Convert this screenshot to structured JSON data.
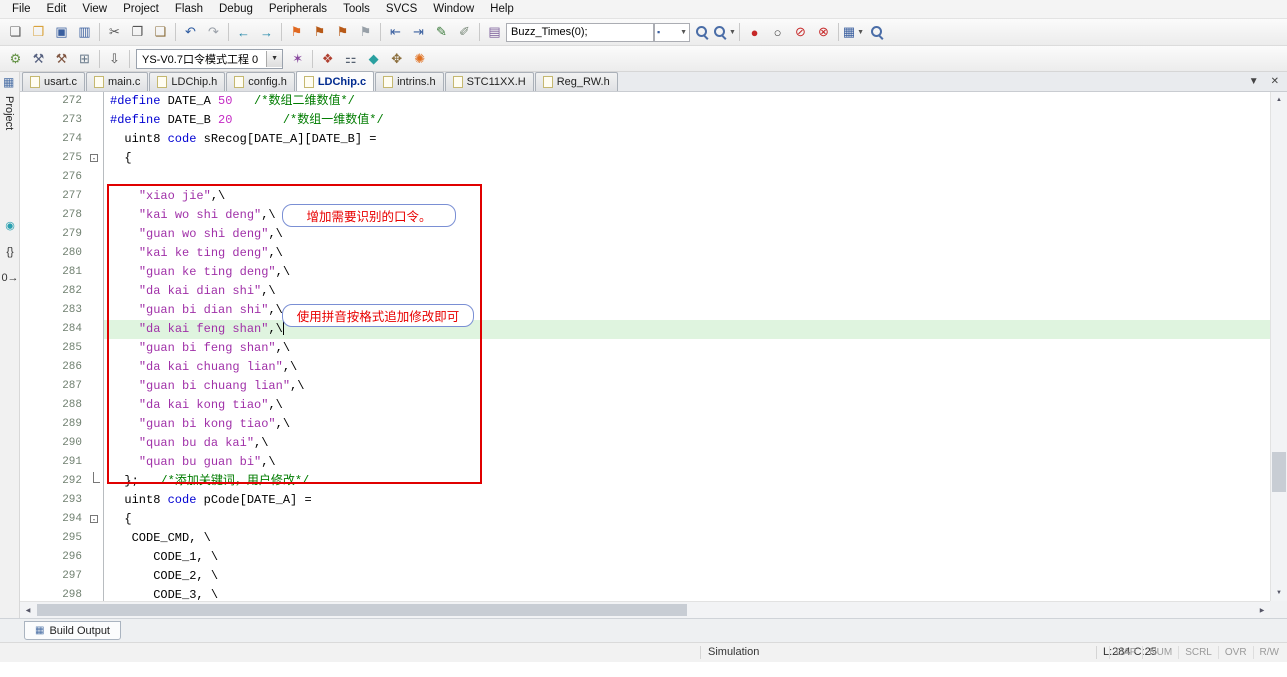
{
  "colors": {
    "keyword": "#0000d2",
    "comment": "#007c00",
    "string": "#a030a8",
    "number": "#c42ac4",
    "line_highlight": "#dff4df",
    "annotation": "#e00000",
    "callout": "#e80000",
    "callout_border": "#7a8fd4"
  },
  "menu": {
    "items": [
      "File",
      "Edit",
      "View",
      "Project",
      "Flash",
      "Debug",
      "Peripherals",
      "Tools",
      "SVCS",
      "Window",
      "Help"
    ]
  },
  "toolbar_main": {
    "items": [
      {
        "name": "new-file-icon",
        "glyph": "❏",
        "color": "#5a5a5a"
      },
      {
        "name": "open-folder-icon",
        "glyph": "❒",
        "color": "#d9a33c"
      },
      {
        "name": "save-icon",
        "glyph": "▣",
        "color": "#3a5f9f"
      },
      {
        "name": "save-all-icon",
        "glyph": "▥",
        "color": "#3a5f9f"
      },
      {
        "sep": true
      },
      {
        "name": "cut-icon",
        "glyph": "✂",
        "color": "#555555"
      },
      {
        "name": "copy-icon",
        "glyph": "❐",
        "color": "#555555"
      },
      {
        "name": "paste-icon",
        "glyph": "❑",
        "color": "#8a6d3b"
      },
      {
        "sep": true
      },
      {
        "name": "undo-icon",
        "glyph": "↶",
        "color": "#2c5aa0"
      },
      {
        "name": "redo-icon",
        "glyph": "↷",
        "color": "#9aa0a8"
      },
      {
        "sep": true
      },
      {
        "name": "navigate-back-icon",
        "glyph": "←",
        "color": "#1f86a8"
      },
      {
        "name": "navigate-forward-icon",
        "glyph": "→",
        "color": "#1f86a8"
      },
      {
        "sep": true
      },
      {
        "name": "bookmark-toggle-icon",
        "glyph": "⚑",
        "color": "#e06820"
      },
      {
        "name": "bookmark-prev-icon",
        "glyph": "⚑",
        "color": "#b85a18"
      },
      {
        "name": "bookmark-next-icon",
        "glyph": "⚑",
        "color": "#b85a18"
      },
      {
        "name": "bookmark-clear-icon",
        "glyph": "⚑",
        "color": "#98a0a8"
      },
      {
        "sep": true
      },
      {
        "name": "outdent-icon",
        "glyph": "⇤",
        "color": "#3a5f9f"
      },
      {
        "name": "indent-icon",
        "glyph": "⇥",
        "color": "#3a5f9f"
      },
      {
        "name": "comment-icon",
        "glyph": "✎",
        "color": "#3a7a3a"
      },
      {
        "name": "uncomment-icon",
        "glyph": "✐",
        "color": "#7a8a7a"
      },
      {
        "sep": true
      },
      {
        "name": "find-notebook-icon",
        "glyph": "▤",
        "color": "#7a5c99"
      },
      {
        "type": "field",
        "name": "find-text-field",
        "value": "Buzz_Times(0);"
      },
      {
        "type": "combo",
        "name": "find-scope-combo"
      },
      {
        "type": "mag",
        "name": "find-in-files-icon"
      },
      {
        "type": "mag",
        "name": "find-icon",
        "dd": true
      },
      {
        "sep": true
      },
      {
        "name": "insert-breakpoint-icon",
        "glyph": "●",
        "color": "#c62828"
      },
      {
        "name": "enable-breakpoint-icon",
        "glyph": "○",
        "color": "#444444"
      },
      {
        "name": "disable-all-breakpoints-icon",
        "glyph": "⊘",
        "color": "#c62828"
      },
      {
        "name": "kill-all-breakpoints-icon",
        "glyph": "⊗",
        "color": "#c62828"
      },
      {
        "sep": true
      },
      {
        "name": "memory-windows-icon",
        "glyph": "▦",
        "color": "#3a5f9f",
        "dd": true
      },
      {
        "type": "mag",
        "name": "help-search-icon"
      }
    ]
  },
  "toolbar_build": {
    "target": "YS-V0.7口令模式工程 0",
    "items": [
      {
        "name": "translate-file-icon",
        "glyph": "⚙",
        "color": "#5f8f3f"
      },
      {
        "name": "build-icon",
        "glyph": "⚒",
        "color": "#55607f"
      },
      {
        "name": "rebuild-icon",
        "glyph": "⚒",
        "color": "#7f5540"
      },
      {
        "name": "batch-build-icon",
        "glyph": "⊞",
        "color": "#667788"
      },
      {
        "sep": true
      },
      {
        "name": "download-flash-icon",
        "glyph": "⇩",
        "color": "#555555"
      },
      {
        "sep": true
      },
      {
        "type": "target",
        "name": "target-select"
      },
      {
        "name": "options-for-target-icon",
        "glyph": "✶",
        "color": "#8a4a9f"
      },
      {
        "sep": true
      },
      {
        "name": "manage-project-items-icon",
        "glyph": "❖",
        "color": "#b04030"
      },
      {
        "name": "file-extensions-icon",
        "glyph": "⚏",
        "color": "#556070"
      },
      {
        "name": "books-window-icon",
        "glyph": "◆",
        "color": "#2aa0a0"
      },
      {
        "name": "functions-window-icon",
        "glyph": "✥",
        "color": "#8a6d3b"
      },
      {
        "name": "pack-installer-icon",
        "glyph": "✺",
        "color": "#e07020"
      }
    ]
  },
  "left_strip": {
    "label": "Project",
    "top_icon": {
      "name": "project-pane-icon",
      "glyph": "▦",
      "color": "#4a6fa5"
    },
    "icons": [
      {
        "name": "books-icon",
        "glyph": "◉",
        "color": "#2aa0b0"
      },
      {
        "name": "functions-icon",
        "glyph": "{}",
        "color": "#333333"
      },
      {
        "name": "templates-icon",
        "glyph": "0→",
        "color": "#333333"
      }
    ]
  },
  "tabs": {
    "items": [
      "usart.c",
      "main.c",
      "LDChip.h",
      "config.h",
      "LDChip.c",
      "intrins.h",
      "STC11XX.H",
      "Reg_RW.h"
    ],
    "active_index": 4,
    "controls": {
      "list": "▼",
      "close": "✕"
    }
  },
  "editor": {
    "scrollbar": {
      "up": "▲",
      "down": "▼",
      "left": "◀",
      "right": "▶"
    },
    "lines": [
      {
        "num": 272,
        "segs": [
          [
            "kw",
            "#define "
          ],
          [
            "pl",
            "DATE_A "
          ],
          [
            "num",
            "50"
          ],
          [
            "pl",
            "   "
          ],
          [
            "cm",
            "/*数组二维数值*/"
          ]
        ]
      },
      {
        "num": 273,
        "segs": [
          [
            "kw",
            "#define "
          ],
          [
            "pl",
            "DATE_B "
          ],
          [
            "num",
            "20"
          ],
          [
            "pl",
            "       "
          ],
          [
            "cm",
            "/*数组一维数值*/"
          ]
        ]
      },
      {
        "num": 274,
        "segs": [
          [
            "pl",
            "  uint8 "
          ],
          [
            "kw",
            "code"
          ],
          [
            "pl",
            " sRecog[DATE_A][DATE_B] ="
          ]
        ]
      },
      {
        "num": 275,
        "fold": "open",
        "segs": [
          [
            "pl",
            "  {"
          ]
        ]
      },
      {
        "num": 276,
        "segs": []
      },
      {
        "num": 277,
        "segs": [
          [
            "pl",
            "    "
          ],
          [
            "str",
            "\"xiao jie\""
          ],
          [
            "pl",
            ",\\"
          ]
        ]
      },
      {
        "num": 278,
        "segs": [
          [
            "pl",
            "    "
          ],
          [
            "str",
            "\"kai wo shi deng\""
          ],
          [
            "pl",
            ",\\"
          ]
        ]
      },
      {
        "num": 279,
        "segs": [
          [
            "pl",
            "    "
          ],
          [
            "str",
            "\"guan wo shi deng\""
          ],
          [
            "pl",
            ",\\"
          ]
        ]
      },
      {
        "num": 280,
        "segs": [
          [
            "pl",
            "    "
          ],
          [
            "str",
            "\"kai ke ting deng\""
          ],
          [
            "pl",
            ",\\"
          ]
        ]
      },
      {
        "num": 281,
        "segs": [
          [
            "pl",
            "    "
          ],
          [
            "str",
            "\"guan ke ting deng\""
          ],
          [
            "pl",
            ",\\"
          ]
        ]
      },
      {
        "num": 282,
        "segs": [
          [
            "pl",
            "    "
          ],
          [
            "str",
            "\"da kai dian shi\""
          ],
          [
            "pl",
            ",\\"
          ]
        ]
      },
      {
        "num": 283,
        "segs": [
          [
            "pl",
            "    "
          ],
          [
            "str",
            "\"guan bi dian shi\""
          ],
          [
            "pl",
            ",\\"
          ]
        ]
      },
      {
        "num": 284,
        "hl": true,
        "caret": true,
        "segs": [
          [
            "pl",
            "    "
          ],
          [
            "str",
            "\"da kai feng shan\""
          ],
          [
            "pl",
            ",\\"
          ]
        ]
      },
      {
        "num": 285,
        "segs": [
          [
            "pl",
            "    "
          ],
          [
            "str",
            "\"guan bi feng shan\""
          ],
          [
            "pl",
            ",\\"
          ]
        ]
      },
      {
        "num": 286,
        "segs": [
          [
            "pl",
            "    "
          ],
          [
            "str",
            "\"da kai chuang lian\""
          ],
          [
            "pl",
            ",\\"
          ]
        ]
      },
      {
        "num": 287,
        "segs": [
          [
            "pl",
            "    "
          ],
          [
            "str",
            "\"guan bi chuang lian\""
          ],
          [
            "pl",
            ",\\"
          ]
        ]
      },
      {
        "num": 288,
        "segs": [
          [
            "pl",
            "    "
          ],
          [
            "str",
            "\"da kai kong tiao\""
          ],
          [
            "pl",
            ",\\"
          ]
        ]
      },
      {
        "num": 289,
        "segs": [
          [
            "pl",
            "    "
          ],
          [
            "str",
            "\"guan bi kong tiao\""
          ],
          [
            "pl",
            ",\\"
          ]
        ]
      },
      {
        "num": 290,
        "segs": [
          [
            "pl",
            "    "
          ],
          [
            "str",
            "\"quan bu da kai\""
          ],
          [
            "pl",
            ",\\"
          ]
        ]
      },
      {
        "num": 291,
        "segs": [
          [
            "pl",
            "    "
          ],
          [
            "str",
            "\"quan bu guan bi\""
          ],
          [
            "pl",
            ",\\"
          ]
        ]
      },
      {
        "num": 292,
        "fold": "end",
        "segs": [
          [
            "pl",
            "  };   "
          ],
          [
            "cm",
            "/*添加关键词，用户修改*/"
          ]
        ]
      },
      {
        "num": 293,
        "segs": [
          [
            "pl",
            "  uint8 "
          ],
          [
            "kw",
            "code"
          ],
          [
            "pl",
            " pCode[DATE_A] ="
          ]
        ]
      },
      {
        "num": 294,
        "fold": "open",
        "segs": [
          [
            "pl",
            "  {"
          ]
        ]
      },
      {
        "num": 295,
        "segs": [
          [
            "pl",
            "   CODE_CMD, \\"
          ]
        ]
      },
      {
        "num": 296,
        "segs": [
          [
            "pl",
            "      CODE_1, \\"
          ]
        ]
      },
      {
        "num": 297,
        "segs": [
          [
            "pl",
            "      CODE_2, \\"
          ]
        ]
      },
      {
        "num": 298,
        "segs": [
          [
            "pl",
            "      CODE_3, \\"
          ]
        ]
      }
    ]
  },
  "annotations": {
    "box1": "增加需要识别的口令。",
    "box2": "使用拼音按格式追加修改即可"
  },
  "build_output": {
    "label": "Build Output",
    "icon": "▦"
  },
  "statusbar": {
    "mode": "Simulation",
    "cursor": "L:284 C:25",
    "flags": [
      "CAP",
      "NUM",
      "SCRL",
      "OVR",
      "R/W"
    ]
  }
}
